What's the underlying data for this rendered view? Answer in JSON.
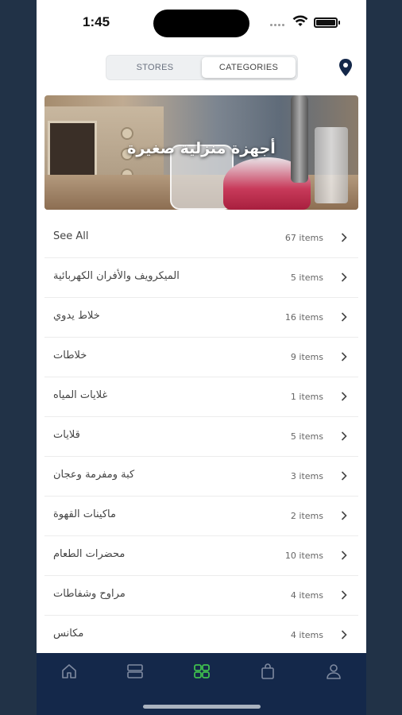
{
  "status_bar": {
    "time": "1:45"
  },
  "toggle": {
    "stores_label": "STORES",
    "categories_label": "CATEGORIES",
    "selected": "CATEGORIES"
  },
  "banner": {
    "title": "أجهزة منزلية صغيرة"
  },
  "categories": [
    {
      "label": "See All",
      "count": "67 items"
    },
    {
      "label": "الميكرويف والأفران الكهربائية",
      "count": "5 items"
    },
    {
      "label": "خلاط يدوي",
      "count": "16 items"
    },
    {
      "label": "خلاطات",
      "count": "9 items"
    },
    {
      "label": "غلايات المياه",
      "count": "1 items"
    },
    {
      "label": "قلايات",
      "count": "5 items"
    },
    {
      "label": "كبة ومفرمة وعجان",
      "count": "3 items"
    },
    {
      "label": "ماكينات القهوة",
      "count": "2 items"
    },
    {
      "label": "محضرات الطعام",
      "count": "10 items"
    },
    {
      "label": "مراوح وشفاطات",
      "count": "4 items"
    },
    {
      "label": "مكانس",
      "count": "4 items"
    }
  ],
  "tab_bar": {
    "items": [
      {
        "icon": "home-icon"
      },
      {
        "icon": "stores-icon"
      },
      {
        "icon": "categories-icon",
        "active": true
      },
      {
        "icon": "bag-icon"
      },
      {
        "icon": "profile-icon"
      }
    ],
    "active_color": "#3fbf4e",
    "inactive_color": "#7f8aa0"
  },
  "colors": {
    "navy": "#14284a",
    "pin": "#14284a"
  }
}
